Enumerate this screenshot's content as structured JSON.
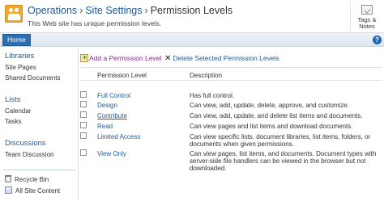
{
  "header": {
    "breadcrumb": [
      "Operations",
      "Site Settings",
      "Permission Levels"
    ],
    "separator": "›",
    "unique_message": "This Web site has unique permission levels.",
    "tags_label_line1": "Tags &",
    "tags_label_line2": "Notes"
  },
  "topnav": {
    "home_tab": "Home",
    "help": "?"
  },
  "quick_launch": {
    "sections": [
      {
        "heading": "Libraries",
        "items": [
          "Site Pages",
          "Shared Documents"
        ]
      },
      {
        "heading": "Lists",
        "items": [
          "Calendar",
          "Tasks"
        ]
      },
      {
        "heading": "Discussions",
        "items": [
          "Team Discussion"
        ]
      }
    ],
    "footer": {
      "recycle_bin": "Recycle Bin",
      "all_site_content": "All Site Content"
    }
  },
  "toolbar": {
    "add_label": "Add a Permission Level",
    "delete_label": "Delete Selected Permission Levels"
  },
  "table": {
    "headers": {
      "level": "Permission Level",
      "description": "Description"
    },
    "rows": [
      {
        "level": "Full Control",
        "description": "Has full control."
      },
      {
        "level": "Design",
        "description": "Can view, add, update, delete, approve, and customize."
      },
      {
        "level": "Contribute",
        "description": "Can view, add, update, and delete list items and documents."
      },
      {
        "level": "Read",
        "description": "Can view pages and list items and download documents."
      },
      {
        "level": "Limited Access",
        "description": "Can view specific lists, document libraries, list items, folders, or documents when given permissions."
      },
      {
        "level": "View Only",
        "description": "Can view pages, list items, and documents. Document types with server-side file handlers can be viewed in the browser but not downloaded."
      }
    ]
  },
  "colors": {
    "link_blue": "#1d5a99",
    "home_tab_bg": "#2f6faf",
    "logo_orange": "#f0a830"
  }
}
